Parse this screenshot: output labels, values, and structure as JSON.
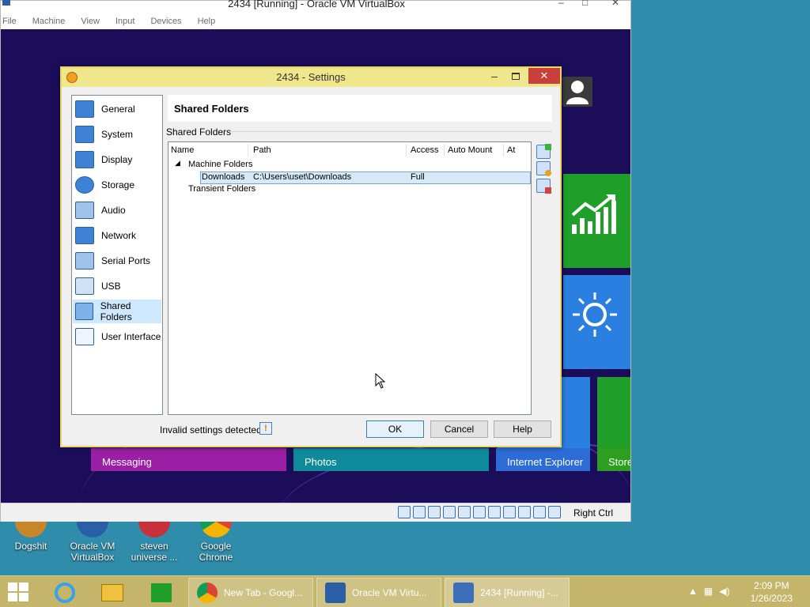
{
  "host": {
    "desktop_icons": [
      {
        "label_line1": "Dogshit",
        "label_line2": "",
        "icon": "dog-icon"
      },
      {
        "label_line1": "Oracle VM",
        "label_line2": "VirtualBox",
        "icon": "virtualbox-icon"
      },
      {
        "label_line1": "steven",
        "label_line2": "universe ...",
        "icon": "game-icon"
      },
      {
        "label_line1": "Google",
        "label_line2": "Chrome",
        "icon": "chrome-icon"
      }
    ]
  },
  "vbox": {
    "title": "2434 [Running] - Oracle VM VirtualBox",
    "menu": [
      "File",
      "Machine",
      "View",
      "Input",
      "Devices",
      "Help"
    ],
    "host_key": "Right Ctrl"
  },
  "guest": {
    "tiles": [
      {
        "label": "Messaging",
        "color": "#9b1fa5"
      },
      {
        "label": "Photos",
        "color": "#0e8b9b"
      },
      {
        "label": "Internet Explorer",
        "color": "#2d6bd6"
      },
      {
        "label": "Store",
        "color": "#2d9e1f"
      }
    ],
    "tile_colors": {
      "finance": "#1f9e2a",
      "weather": "#2b7fe0"
    }
  },
  "dialog": {
    "title": "2434 - Settings",
    "nav": [
      {
        "label": "General",
        "icon": "general-icon"
      },
      {
        "label": "System",
        "icon": "system-icon"
      },
      {
        "label": "Display",
        "icon": "display-icon"
      },
      {
        "label": "Storage",
        "icon": "storage-icon"
      },
      {
        "label": "Audio",
        "icon": "audio-icon"
      },
      {
        "label": "Network",
        "icon": "network-icon"
      },
      {
        "label": "Serial Ports",
        "icon": "serial-ports-icon"
      },
      {
        "label": "USB",
        "icon": "usb-icon"
      },
      {
        "label": "Shared Folders",
        "icon": "shared-folders-icon",
        "selected": true
      },
      {
        "label": "User Interface",
        "icon": "user-interface-icon"
      }
    ],
    "page_title": "Shared Folders",
    "group_label": "Shared Folders",
    "columns": [
      "Name",
      "Path",
      "Access",
      "Auto Mount",
      "At"
    ],
    "tree": {
      "machine_folders": "Machine Folders",
      "transient_folders": "Transient Folders",
      "rows": [
        {
          "name": "Downloads",
          "path": "C:\\Users\\uset\\Downloads",
          "access": "Full",
          "auto_mount": "",
          "at": ""
        }
      ]
    },
    "status": "Invalid settings detected",
    "buttons": {
      "ok": "OK",
      "cancel": "Cancel",
      "help": "Help"
    }
  },
  "taskbar": {
    "tasks": [
      {
        "label": "New Tab - Googl...",
        "icon": "chrome-icon"
      },
      {
        "label": "Oracle VM Virtu...",
        "icon": "virtualbox-icon"
      },
      {
        "label": "2434 [Running] -...",
        "icon": "vm-running-icon"
      }
    ],
    "time": "2:09 PM",
    "date": "1/26/2023"
  }
}
